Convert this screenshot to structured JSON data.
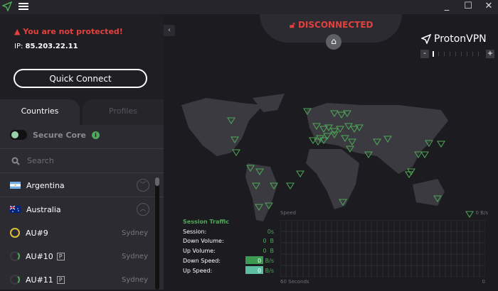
{
  "titlebar": {
    "minimize": "_",
    "maximize": "☐",
    "close": "✕"
  },
  "status": {
    "warning": "You are not protected!",
    "ip_label": "IP:",
    "ip": "85.203.22.11",
    "quick_connect": "Quick Connect"
  },
  "tabs": [
    {
      "label": "Countries",
      "active": true
    },
    {
      "label": "Profiles",
      "active": false
    }
  ],
  "secure_core": {
    "label": "Secure Core",
    "enabled": false,
    "info": "i"
  },
  "search": {
    "placeholder": "Search"
  },
  "countries": [
    {
      "name": "Argentina",
      "expanded": false
    },
    {
      "name": "Australia",
      "expanded": true,
      "servers": [
        {
          "name": "AU#9",
          "plus": false,
          "city": "Sydney",
          "load_color": "#d8c23a"
        },
        {
          "name": "AU#10",
          "plus": true,
          "city": "Sydney",
          "load_color": "#4ea956"
        },
        {
          "name": "AU#11",
          "plus": true,
          "city": "Sydney",
          "load_color": "#4ea956"
        }
      ]
    }
  ],
  "plus_badge": "P",
  "map": {
    "status": "DISCONNECTED",
    "brand": "ProtonVPN",
    "zoom_minus": "-",
    "zoom_plus": "+",
    "zoom_level": 0
  },
  "traffic": {
    "title": "Session Traffic",
    "rows": [
      {
        "label": "Session:",
        "value": "0s",
        "unit": ""
      },
      {
        "label": "Down Volume:",
        "value": "0",
        "unit": "B"
      },
      {
        "label": "Up Volume:",
        "value": "0",
        "unit": "B"
      }
    ],
    "down_speed": {
      "label": "Down Speed:",
      "value": "0",
      "unit": "B/s"
    },
    "up_speed": {
      "label": "Up Speed:",
      "value": "0",
      "unit": "B/s"
    }
  },
  "graph": {
    "title": "Speed",
    "y_unit": "0 B/s",
    "x_label": "60 Seconds",
    "x_end": "0"
  },
  "colors": {
    "accent": "#4ea956",
    "danger": "#e3413e",
    "up": "#5cc0a0"
  }
}
